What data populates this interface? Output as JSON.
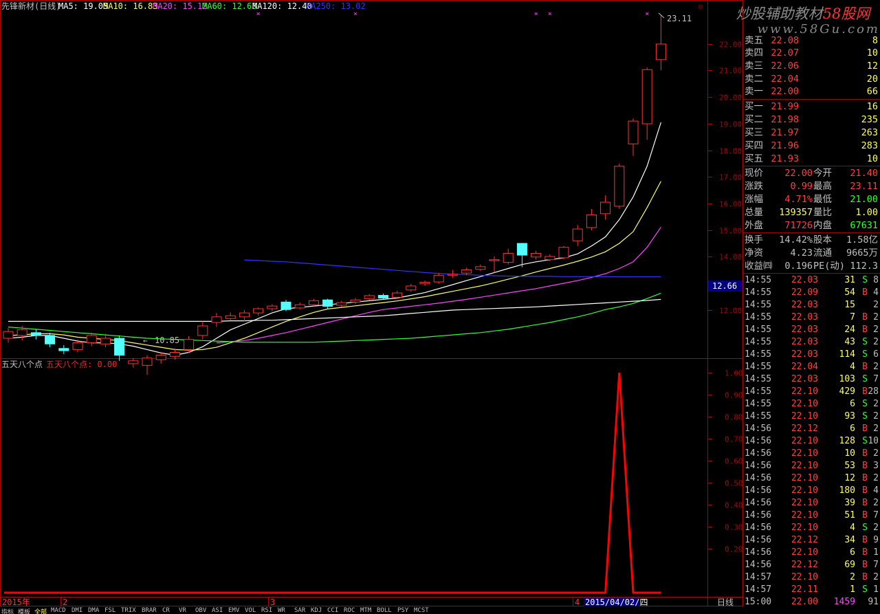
{
  "header": {
    "stock_name": "先锋新材(日线)",
    "ma_items": [
      {
        "text": "MA5: 19.05",
        "color": "#ffffff"
      },
      {
        "text": "MA10: 16.83",
        "color": "#ffff66"
      },
      {
        "text": "MA20: 15.12",
        "color": "#ff44ff"
      },
      {
        "text": "MA60: 12.63",
        "color": "#33ff33"
      },
      {
        "text": "MA120: 12.40",
        "color": "#ffffff"
      },
      {
        "text": "MA250: 13.02",
        "color": "#3333ff"
      }
    ]
  },
  "price_axis": {
    "ticks": [
      "22.00",
      "21.00",
      "20.00",
      "19.00",
      "18.00",
      "17.00",
      "16.00",
      "15.00",
      "14.00",
      "12.00"
    ],
    "current_label": "12.66"
  },
  "annotations": {
    "high_label": "23.11",
    "low_label": "10.85"
  },
  "indicator": {
    "name": "五天八个点",
    "value_label": "五天八个点: 0.00",
    "ticks": [
      "1.00",
      "0.90",
      "0.80",
      "0.70",
      "0.60",
      "0.50",
      "0.40",
      "0.30",
      "0.20"
    ]
  },
  "time_axis": {
    "labels": [
      "2015年",
      "2",
      "3",
      "4"
    ],
    "date_label": "2015/04/02/四",
    "period_label": "日线"
  },
  "chart_data": [
    {
      "type": "candlestick",
      "title": "先锋新材(日线)",
      "ylim": [
        10.5,
        23.3
      ],
      "candles": [
        [
          11.5,
          11.62,
          11.68,
          11.42
        ],
        [
          11.55,
          11.65,
          11.72,
          11.46
        ],
        [
          11.6,
          11.55,
          11.66,
          11.48
        ],
        [
          11.55,
          11.4,
          11.6,
          11.34
        ],
        [
          11.32,
          11.28,
          11.38,
          11.22
        ],
        [
          11.3,
          11.42,
          11.48,
          11.25
        ],
        [
          11.42,
          11.55,
          11.6,
          11.36
        ],
        [
          11.4,
          11.5,
          11.58,
          11.34
        ],
        [
          11.5,
          11.2,
          11.55,
          11.1
        ],
        [
          11.05,
          11.1,
          11.15,
          10.98
        ],
        [
          11.02,
          11.15,
          11.2,
          10.85
        ],
        [
          11.12,
          11.2,
          11.26,
          11.05
        ],
        [
          11.18,
          11.25,
          11.32,
          11.12
        ],
        [
          11.3,
          11.48,
          11.54,
          11.24
        ],
        [
          11.55,
          11.72,
          11.8,
          11.48
        ],
        [
          11.78,
          11.88,
          11.95,
          11.7
        ],
        [
          11.85,
          11.9,
          11.96,
          11.82
        ],
        [
          11.88,
          11.95,
          12.0,
          11.8
        ],
        [
          11.95,
          12.05,
          12.1,
          11.9
        ],
        [
          12.05,
          12.15,
          12.22,
          11.98
        ],
        [
          12.3,
          12.02,
          12.38,
          11.98
        ],
        [
          12.08,
          12.2,
          12.28,
          12.02
        ],
        [
          12.2,
          12.35,
          12.42,
          12.14
        ],
        [
          12.38,
          12.14,
          12.42,
          12.05
        ],
        [
          12.18,
          12.28,
          12.35,
          12.12
        ],
        [
          12.3,
          12.38,
          12.45,
          12.22
        ],
        [
          12.42,
          12.54,
          12.6,
          12.36
        ],
        [
          12.55,
          12.45,
          12.62,
          12.4
        ],
        [
          12.48,
          12.64,
          12.72,
          12.42
        ],
        [
          12.75,
          12.9,
          12.98,
          12.68
        ],
        [
          12.98,
          13.04,
          13.1,
          12.9
        ],
        [
          13.05,
          13.3,
          13.38,
          12.98
        ],
        [
          13.3,
          13.34,
          13.5,
          13.2
        ],
        [
          13.38,
          13.5,
          13.58,
          13.3
        ],
        [
          13.52,
          13.62,
          13.7,
          13.46
        ],
        [
          13.85,
          13.88,
          14.0,
          13.4
        ],
        [
          13.78,
          14.12,
          14.3,
          13.7
        ],
        [
          14.5,
          14.05,
          14.52,
          13.6
        ],
        [
          13.98,
          14.12,
          14.22,
          13.88
        ],
        [
          13.88,
          14.0,
          14.08,
          13.82
        ],
        [
          13.95,
          14.35,
          14.4,
          13.88
        ],
        [
          14.6,
          15.05,
          15.2,
          14.4
        ],
        [
          15.1,
          15.58,
          15.8,
          15.0
        ],
        [
          15.62,
          16.05,
          16.3,
          15.4
        ],
        [
          15.9,
          17.4,
          17.5,
          15.8
        ],
        [
          18.25,
          19.1,
          19.2,
          17.8
        ],
        [
          19.0,
          21.02,
          21.1,
          18.4
        ],
        [
          21.4,
          22.0,
          23.11,
          21.0
        ]
      ],
      "ma_lines": [
        {
          "name": "MA5",
          "color": "#ffffff",
          "values": [
            11.5,
            11.52,
            11.55,
            11.55,
            11.5,
            11.45,
            11.42,
            11.42,
            11.4,
            11.36,
            11.3,
            11.24,
            11.2,
            11.25,
            11.35,
            11.5,
            11.65,
            11.75,
            11.85,
            11.95,
            12.05,
            12.1,
            12.15,
            12.2,
            12.25,
            12.3,
            12.35,
            12.4,
            12.45,
            12.55,
            12.65,
            12.8,
            12.95,
            13.1,
            13.25,
            13.4,
            13.55,
            13.7,
            13.8,
            13.88,
            13.95,
            14.1,
            14.4,
            14.75,
            15.4,
            16.25,
            17.4,
            19.05
          ]
        },
        {
          "name": "MA10",
          "color": "#ffff66",
          "values": [
            11.55,
            11.56,
            11.58,
            11.58,
            11.56,
            11.52,
            11.5,
            11.48,
            11.46,
            11.42,
            11.38,
            11.34,
            11.3,
            11.29,
            11.3,
            11.34,
            11.42,
            11.5,
            11.6,
            11.7,
            11.8,
            11.88,
            11.96,
            12.04,
            12.1,
            12.16,
            12.22,
            12.28,
            12.34,
            12.42,
            12.5,
            12.6,
            12.7,
            12.8,
            12.9,
            13.02,
            13.15,
            13.28,
            13.42,
            13.55,
            13.68,
            13.82,
            13.98,
            14.18,
            14.5,
            14.95,
            15.85,
            16.83
          ]
        },
        {
          "name": "MA20",
          "color": "#ff44ff",
          "values": [
            null,
            null,
            null,
            null,
            null,
            null,
            null,
            null,
            null,
            null,
            null,
            null,
            null,
            null,
            null,
            11.42,
            11.44,
            11.46,
            11.5,
            11.55,
            11.6,
            11.66,
            11.72,
            11.78,
            11.84,
            11.9,
            11.96,
            12.02,
            12.08,
            12.14,
            12.2,
            12.26,
            12.33,
            12.4,
            12.48,
            12.56,
            12.64,
            12.72,
            12.8,
            12.9,
            13.0,
            13.1,
            13.22,
            13.36,
            13.55,
            13.8,
            14.35,
            15.12
          ]
        },
        {
          "name": "MA60",
          "color": "#33ff33",
          "values": [
            11.7,
            11.68,
            11.66,
            11.64,
            11.62,
            11.6,
            11.58,
            11.56,
            11.54,
            11.52,
            11.5,
            11.49,
            11.48,
            11.47,
            11.46,
            11.45,
            11.44,
            11.43,
            11.43,
            11.43,
            11.43,
            11.43,
            11.43,
            11.44,
            11.45,
            11.46,
            11.47,
            11.48,
            11.49,
            11.5,
            11.52,
            11.54,
            11.56,
            11.58,
            11.6,
            11.63,
            11.66,
            11.7,
            11.74,
            11.78,
            11.83,
            11.88,
            11.94,
            12.02,
            12.12,
            12.25,
            12.43,
            12.63
          ]
        },
        {
          "name": "MA120",
          "color": "#ffffff",
          "values": [
            11.8,
            11.8,
            11.8,
            11.8,
            11.8,
            11.8,
            11.8,
            11.8,
            11.8,
            11.8,
            11.8,
            11.8,
            11.8,
            11.8,
            11.8,
            11.8,
            11.81,
            11.81,
            11.82,
            11.82,
            11.83,
            11.84,
            11.85,
            11.86,
            11.87,
            11.88,
            11.89,
            11.9,
            11.92,
            11.94,
            11.96,
            11.98,
            12.0,
            12.02,
            12.04,
            12.06,
            12.08,
            12.1,
            12.12,
            12.15,
            12.18,
            12.21,
            12.24,
            12.27,
            12.3,
            12.33,
            12.36,
            12.4
          ]
        },
        {
          "name": "MA250",
          "color": "#3333ff",
          "values": [
            null,
            null,
            null,
            null,
            null,
            null,
            null,
            null,
            null,
            null,
            null,
            null,
            null,
            null,
            null,
            null,
            null,
            13.87,
            13.85,
            13.82,
            13.8,
            13.76,
            13.72,
            13.68,
            13.64,
            13.6,
            13.56,
            13.52,
            13.48,
            13.44,
            13.4,
            13.37,
            13.34,
            13.32,
            13.3,
            13.28,
            13.27,
            13.26,
            13.26,
            13.26,
            13.25,
            13.25,
            13.25,
            13.24,
            13.24,
            13.24,
            13.24,
            13.24
          ]
        }
      ]
    },
    {
      "type": "line",
      "title": "五天八个点",
      "ylim": [
        0,
        1.05
      ],
      "values": [
        0,
        0,
        0,
        0,
        0,
        0,
        0,
        0,
        0,
        0,
        0,
        0,
        0,
        0,
        0,
        0,
        0,
        0,
        0,
        0,
        0,
        0,
        0,
        0,
        0,
        0,
        0,
        0,
        0,
        0,
        0,
        0,
        0,
        0,
        0,
        0,
        0,
        0,
        0,
        0,
        0,
        0,
        0,
        0,
        1,
        0,
        0,
        0
      ],
      "color": "#ff0000"
    }
  ],
  "order_book": {
    "asks": [
      {
        "label": "卖五",
        "price": "22.08",
        "vol": "8"
      },
      {
        "label": "卖四",
        "price": "22.07",
        "vol": "10"
      },
      {
        "label": "卖三",
        "price": "22.06",
        "vol": "12"
      },
      {
        "label": "卖二",
        "price": "22.04",
        "vol": "20"
      },
      {
        "label": "卖一",
        "price": "22.00",
        "vol": "66"
      }
    ],
    "bids": [
      {
        "label": "买一",
        "price": "21.99",
        "vol": "16"
      },
      {
        "label": "买二",
        "price": "21.98",
        "vol": "235"
      },
      {
        "label": "买三",
        "price": "21.97",
        "vol": "263"
      },
      {
        "label": "买四",
        "price": "21.96",
        "vol": "283"
      },
      {
        "label": "买五",
        "price": "21.93",
        "vol": "10"
      }
    ]
  },
  "quote": [
    {
      "l1": "现价",
      "v1": "22.00",
      "c1": "#ff4040",
      "l2": "今开",
      "v2": "21.40",
      "c2": "#ff4040"
    },
    {
      "l1": "涨跌",
      "v1": "0.99",
      "c1": "#ff4040",
      "l2": "最高",
      "v2": "23.11",
      "c2": "#ff4040"
    },
    {
      "l1": "涨幅",
      "v1": "4.71%",
      "c1": "#ff4040",
      "l2": "最低",
      "v2": "21.00",
      "c2": "#33ff33"
    },
    {
      "l1": "总量",
      "v1": "139357",
      "c1": "#ffff66",
      "l2": "量比",
      "v2": "1.00",
      "c2": "#ffff66"
    },
    {
      "l1": "外盘",
      "v1": "71726",
      "c1": "#ff4040",
      "l2": "内盘",
      "v2": "67631",
      "c2": "#33ff33"
    }
  ],
  "fundamentals": [
    {
      "l1": "换手",
      "v1": "14.42%",
      "l2": "股本",
      "v2": "1.58亿"
    },
    {
      "l1": "净资",
      "v1": "4.23",
      "l2": "流通",
      "v2": "9665万"
    },
    {
      "l1": "收益㈣",
      "v1": "0.196",
      "l2": "PE(动)",
      "v2": "112.3"
    }
  ],
  "ticks": [
    {
      "time": "14:55",
      "price": "22.03",
      "vol": "31",
      "bs": "S",
      "n": "8"
    },
    {
      "time": "14:55",
      "price": "22.09",
      "vol": "54",
      "bs": "B",
      "n": "4"
    },
    {
      "time": "14:55",
      "price": "22.03",
      "vol": "15",
      "bs": "",
      "n": "2"
    },
    {
      "time": "14:55",
      "price": "22.03",
      "vol": "7",
      "bs": "B",
      "n": "2"
    },
    {
      "time": "14:55",
      "price": "22.03",
      "vol": "24",
      "bs": "B",
      "n": "2"
    },
    {
      "time": "14:55",
      "price": "22.03",
      "vol": "43",
      "bs": "S",
      "n": "2"
    },
    {
      "time": "14:55",
      "price": "22.03",
      "vol": "114",
      "bs": "S",
      "n": "6"
    },
    {
      "time": "14:55",
      "price": "22.04",
      "vol": "4",
      "bs": "B",
      "n": "2"
    },
    {
      "time": "14:55",
      "price": "22.03",
      "vol": "103",
      "bs": "S",
      "n": "7"
    },
    {
      "time": "14:55",
      "price": "22.10",
      "vol": "429",
      "bs": "B",
      "n": "28"
    },
    {
      "time": "14:55",
      "price": "22.10",
      "vol": "6",
      "bs": "S",
      "n": "2"
    },
    {
      "time": "14:55",
      "price": "22.10",
      "vol": "93",
      "bs": "S",
      "n": "2"
    },
    {
      "time": "14:56",
      "price": "22.12",
      "vol": "6",
      "bs": "B",
      "n": "2"
    },
    {
      "time": "14:56",
      "price": "22.10",
      "vol": "128",
      "bs": "S",
      "n": "10"
    },
    {
      "time": "14:56",
      "price": "22.10",
      "vol": "10",
      "bs": "B",
      "n": "2"
    },
    {
      "time": "14:56",
      "price": "22.10",
      "vol": "53",
      "bs": "B",
      "n": "3"
    },
    {
      "time": "14:56",
      "price": "22.10",
      "vol": "12",
      "bs": "B",
      "n": "2"
    },
    {
      "time": "14:56",
      "price": "22.10",
      "vol": "180",
      "bs": "B",
      "n": "4"
    },
    {
      "time": "14:56",
      "price": "22.10",
      "vol": "39",
      "bs": "B",
      "n": "2"
    },
    {
      "time": "14:56",
      "price": "22.10",
      "vol": "51",
      "bs": "B",
      "n": "7"
    },
    {
      "time": "14:56",
      "price": "22.10",
      "vol": "4",
      "bs": "S",
      "n": "2"
    },
    {
      "time": "14:56",
      "price": "22.12",
      "vol": "34",
      "bs": "B",
      "n": "9"
    },
    {
      "time": "14:56",
      "price": "22.10",
      "vol": "6",
      "bs": "B",
      "n": "1"
    },
    {
      "time": "14:56",
      "price": "22.12",
      "vol": "69",
      "bs": "B",
      "n": "7"
    },
    {
      "time": "14:57",
      "price": "22.10",
      "vol": "2",
      "bs": "B",
      "n": "2"
    },
    {
      "time": "14:57",
      "price": "22.11",
      "vol": "1",
      "bs": "S",
      "n": "1"
    },
    {
      "time": "15:00",
      "price": "22.00",
      "vol": "1459",
      "bs": "",
      "n": "91"
    }
  ],
  "watermark": {
    "line1_a": "炒股辅助教材",
    "line1_b": "58股网",
    "line2": "www.58Gu.com"
  },
  "tabs": [
    "指标",
    "模板",
    "全部",
    "MACD",
    "DMI",
    "DMA",
    "FSL",
    "TRIX",
    "BRAR",
    "CR",
    "VR",
    "OBV",
    "ASI",
    "EMV",
    "VOL",
    "RSI",
    "WR",
    "SAR",
    "KDJ",
    "CCI",
    "ROC",
    "MTM",
    "BOLL",
    "PSY",
    "MCST"
  ]
}
